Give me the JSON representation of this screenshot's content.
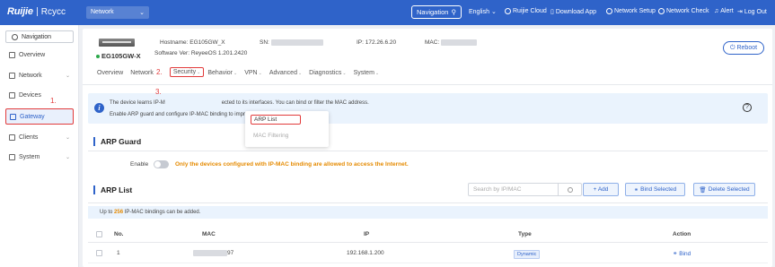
{
  "topbar": {
    "logo_ruijie": "Ruijie",
    "logo_rcycc": "Rcycc",
    "network_select": "Network",
    "navigation_label": "Navigation",
    "language": "English",
    "ruijie_cloud": "Ruijie Cloud",
    "download_app": "Download App",
    "network_setup": "Network Setup",
    "network_check": "Network Check",
    "alert": "Alert",
    "logout": "Log Out"
  },
  "sidebar": {
    "nav_label": "Navigation",
    "items": [
      {
        "label": "Overview",
        "icon": "dashboard-icon"
      },
      {
        "label": "Network",
        "icon": "network-icon"
      },
      {
        "label": "Devices",
        "icon": "devices-icon"
      },
      {
        "label": "Gateway",
        "icon": "gateway-icon"
      },
      {
        "label": "Clients",
        "icon": "clients-icon"
      },
      {
        "label": "System",
        "icon": "system-icon"
      }
    ],
    "step1": "1."
  },
  "device": {
    "model": "EG105GW-X",
    "hostname_label": "Hostname:",
    "hostname": "EG105GW_X",
    "software_label": "Software Ver:",
    "software": "ReyeeOS 1.201.2420",
    "sn_label": "SN:",
    "ip_label": "IP:",
    "ip": "172.26.6.20",
    "mac_label": "MAC:",
    "reboot": "Reboot"
  },
  "tabs": [
    "Overview",
    "Network",
    "Security",
    "Behavior",
    "VPN",
    "Advanced",
    "Diagnostics",
    "System"
  ],
  "steps": {
    "s2": "2.",
    "s3": "3."
  },
  "dropdown": {
    "arp_list": "ARP List",
    "mac_filtering": "MAC Filtering"
  },
  "banner": {
    "line1a": "The device learns IP-M",
    "line1b": "ected to its interfaces. You can bind or filter the MAC address.",
    "line2a": "Enable ARP guard and configure IP-MAC binding to improve network security."
  },
  "arp_guard": {
    "title": "ARP Guard",
    "enable_label": "Enable",
    "warning": "Only the devices configured with IP-MAC binding are allowed to access the Internet."
  },
  "arp_list": {
    "title": "ARP List",
    "search_placeholder": "Search by IP/MAC",
    "add": "+ Add",
    "bind_selected": "Bind Selected",
    "delete_selected": "Delete Selected",
    "limit_prefix": "Up to",
    "limit_num": "256",
    "limit_suffix": "IP-MAC bindings can be added.",
    "columns": [
      "No.",
      "MAC",
      "IP",
      "Type",
      "Action"
    ],
    "rows": [
      {
        "no": "1",
        "mac": "97",
        "ip": "192.168.1.200",
        "type": "Dynamic",
        "action": "Bind"
      }
    ]
  }
}
